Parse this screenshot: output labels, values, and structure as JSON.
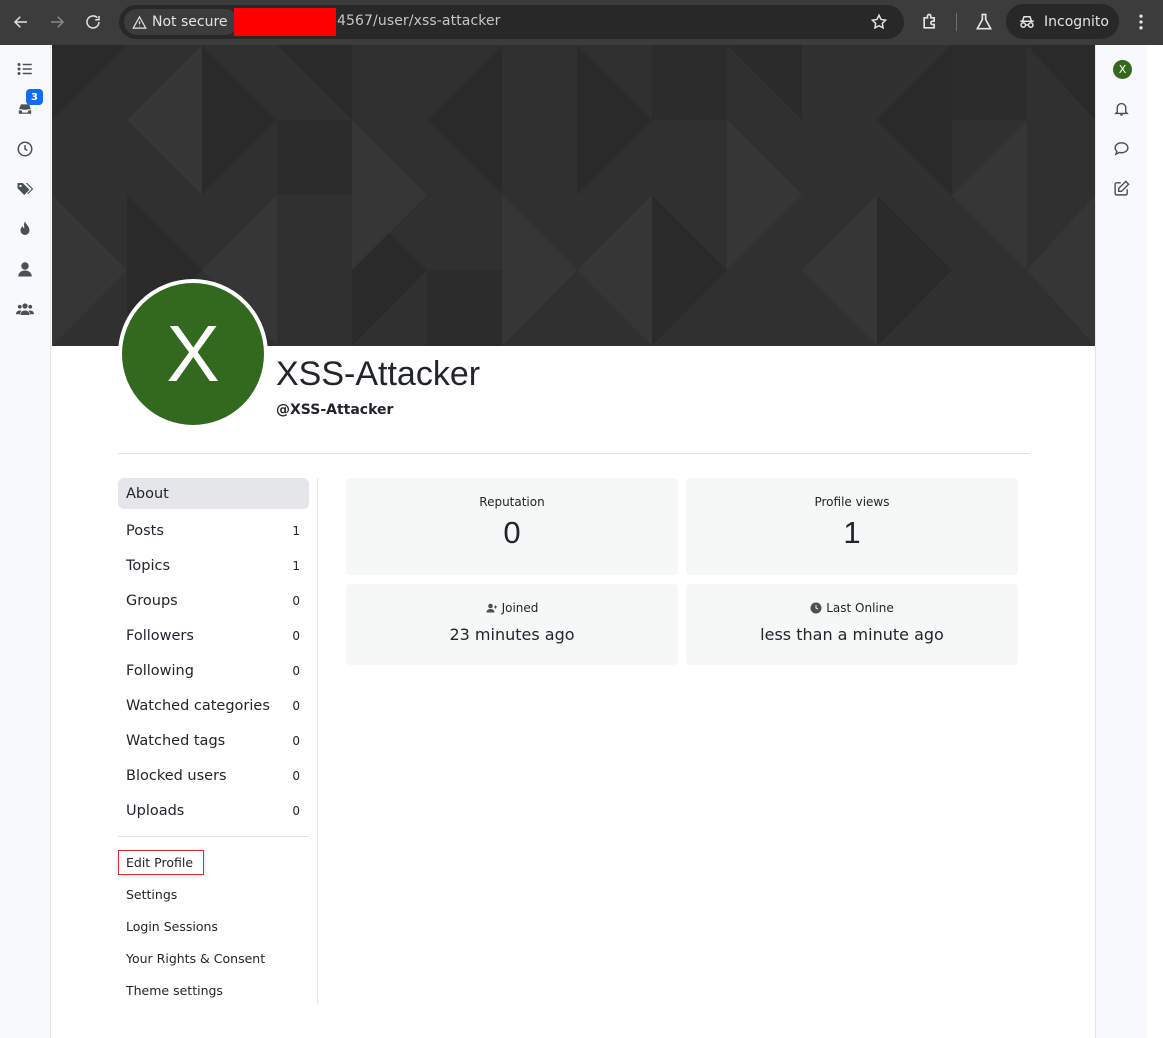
{
  "browser": {
    "security_label": "Not secure",
    "url": "4567/user/xss-attacker",
    "profile_mode": "Incognito"
  },
  "left_nav": {
    "notification_count": "3",
    "icons": [
      "list-icon",
      "inbox-icon",
      "clock-icon",
      "tags-icon",
      "fire-icon",
      "user-icon",
      "users-icon"
    ]
  },
  "right_nav": {
    "avatar_letter": "X",
    "icons": [
      "bell-icon",
      "chat-icon",
      "compose-icon"
    ]
  },
  "profile": {
    "avatar_letter": "X",
    "avatar_color": "#33691e",
    "display_name": "XSS-Attacker",
    "username": "@XSS-Attacker"
  },
  "account_nav": {
    "items": [
      {
        "label": "About",
        "count": ""
      },
      {
        "label": "Posts",
        "count": "1"
      },
      {
        "label": "Topics",
        "count": "1"
      },
      {
        "label": "Groups",
        "count": "0"
      },
      {
        "label": "Followers",
        "count": "0"
      },
      {
        "label": "Following",
        "count": "0"
      },
      {
        "label": "Watched categories",
        "count": "0"
      },
      {
        "label": "Watched tags",
        "count": "0"
      },
      {
        "label": "Blocked users",
        "count": "0"
      },
      {
        "label": "Uploads",
        "count": "0"
      }
    ],
    "settings": [
      "Edit Profile",
      "Settings",
      "Login Sessions",
      "Your Rights & Consent",
      "Theme settings"
    ]
  },
  "stats": {
    "reputation_label": "Reputation",
    "reputation_value": "0",
    "views_label": "Profile views",
    "views_value": "1",
    "joined_label": "Joined",
    "joined_value": "23 minutes ago",
    "online_label": "Last Online",
    "online_value": "less than a minute ago"
  }
}
